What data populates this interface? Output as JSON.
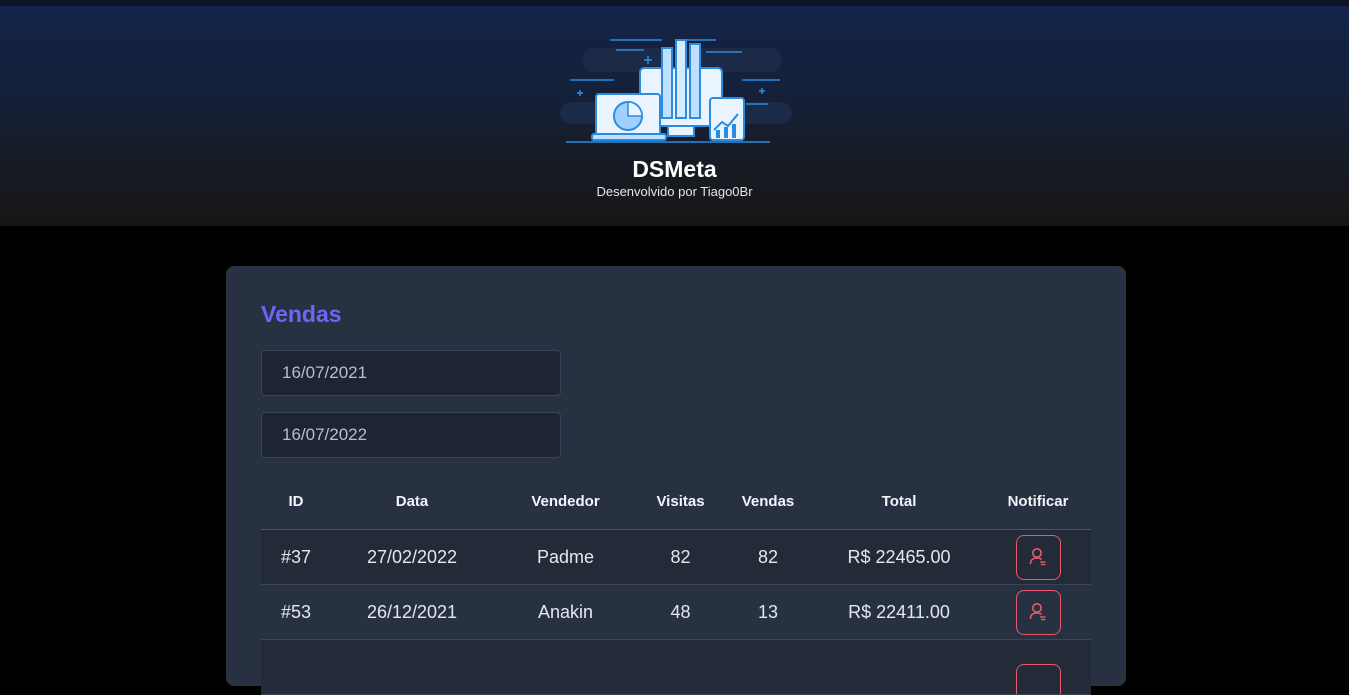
{
  "header": {
    "title": "DSMeta",
    "subtitle": "Desenvolvido por Tiago0Br",
    "logo_icon": "analytics-devices-illustration"
  },
  "sales": {
    "title": "Vendas",
    "min_date": "16/07/2021",
    "max_date": "16/07/2022",
    "columns": [
      "ID",
      "Data",
      "Vendedor",
      "Visitas",
      "Vendas",
      "Total",
      "Notificar"
    ],
    "rows": [
      {
        "id": "#37",
        "date": "27/02/2022",
        "seller": "Padme",
        "visits": "82",
        "deals": "82",
        "total": "R$ 22465.00"
      },
      {
        "id": "#53",
        "date": "26/12/2021",
        "seller": "Anakin",
        "visits": "48",
        "deals": "13",
        "total": "R$ 22411.00"
      }
    ],
    "notify_icon": "user-notify-icon"
  },
  "colors": {
    "accent": "#6b66f5",
    "card": "#283142",
    "notify": "#e35b6a",
    "input_bg": "#1e2532"
  }
}
